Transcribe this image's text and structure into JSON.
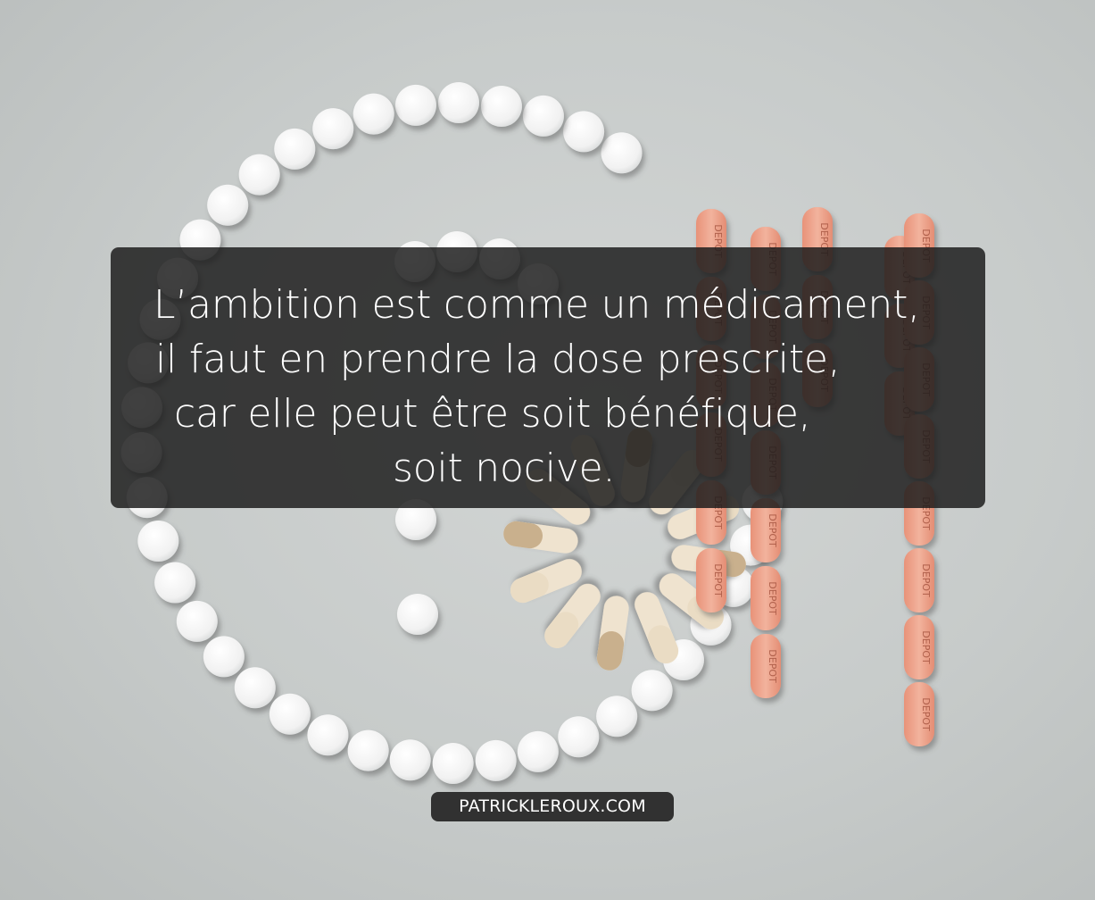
{
  "image": {
    "quote_lines": [
      "L’ambition est comme un médicament,",
      "il faut en prendre la dose prescrite,",
      "car elle peut être soit bénéfique,",
      "soit nocive."
    ],
    "website": "PATRICKLEROUX.COM",
    "pill_imprint": "DEPOT",
    "colors": {
      "background": "#c9cccb",
      "quote_box": "#1c1c1c",
      "text": "#ffffff",
      "white_tablet": "#fafafa",
      "capsule": "#e8d8bf",
      "salmon_tablet": "#eda58e"
    }
  }
}
